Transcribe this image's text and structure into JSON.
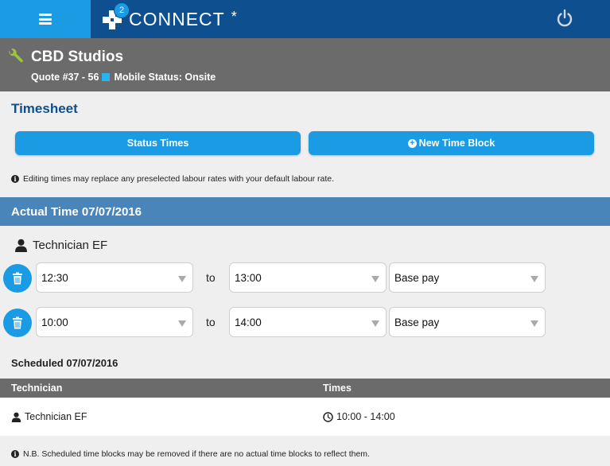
{
  "app": {
    "logo_text": "CONNECT",
    "logo_star": "*",
    "notification_count": "2",
    "colors": {
      "topbar": "#0e4f8f",
      "accent": "#1a9be3",
      "section": "#4a85b9",
      "jobbar": "#6b6b6b",
      "status_square": "#29b3f0"
    }
  },
  "job": {
    "title": "CBD Studios",
    "quote": "Quote #37 - 56",
    "mobile_status": "Mobile Status: Onsite"
  },
  "timesheet": {
    "heading": "Timesheet",
    "status_times_label": "Status Times",
    "new_time_block_label": "New Time Block",
    "note": "Editing times may replace any preselected labour rates with your default labour rate."
  },
  "actual": {
    "heading": "Actual Time 07/07/2016",
    "technician": "Technician EF",
    "to_label": "to",
    "rows": [
      {
        "start": "12:30",
        "end": "13:00",
        "rate": "Base pay"
      },
      {
        "start": "10:00",
        "end": "14:00",
        "rate": "Base pay"
      }
    ]
  },
  "scheduled": {
    "heading": "Scheduled 07/07/2016",
    "columns": [
      "Technician",
      "Times"
    ],
    "rows": [
      {
        "technician": "Technician EF",
        "times": "10:00 - 14:00"
      }
    ],
    "note": "N.B. Scheduled time blocks may be removed if there are no actual time blocks to reflect them."
  }
}
